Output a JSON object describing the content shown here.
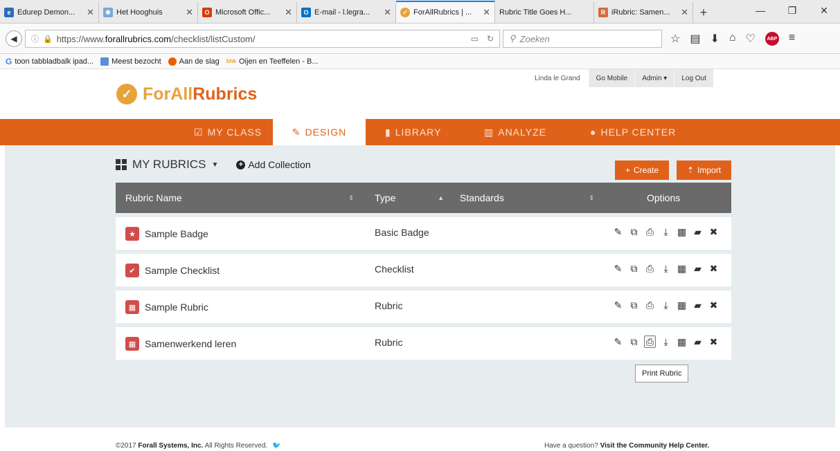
{
  "browser": {
    "tabs": [
      {
        "title": "Edurep Demon...",
        "favicon_color": "#2d6bb7",
        "active": false
      },
      {
        "title": "Het Hooghuis",
        "favicon_color": "#7aa7d6",
        "active": false
      },
      {
        "title": "Microsoft Offic...",
        "favicon_color": "#d83b01",
        "active": false
      },
      {
        "title": "E-mail - l.legra...",
        "favicon_color": "#0072c6",
        "active": false
      },
      {
        "title": "ForAllRubrics | ...",
        "favicon_color": "#e8a23a",
        "active": true
      },
      {
        "title": "Rubric Title Goes H...",
        "favicon_color": "",
        "active": false
      },
      {
        "title": "iRubric: Samen...",
        "favicon_color": "#d86a3a",
        "active": false
      }
    ],
    "url_prefix": "https://www.",
    "url_domain": "forallrubrics.com",
    "url_path": "/checklist/listCustom/",
    "search_placeholder": "Zoeken",
    "bookmarks": [
      {
        "label": "toon tabbladbalk ipad...",
        "icon": "google-icon"
      },
      {
        "label": "Meest bezocht",
        "icon": "most-visited-icon"
      },
      {
        "label": "Aan de slag",
        "icon": "firefox-icon"
      },
      {
        "label": "Oijen en Teeffelen - B...",
        "icon": "bhk-icon"
      }
    ]
  },
  "site": {
    "logo_text_a": "ForAll",
    "logo_text_b": "Rubrics",
    "user_name": "Linda le Grand",
    "go_mobile": "Go Mobile",
    "admin": "Admin ▾",
    "logout": "Log Out",
    "nav": [
      {
        "label": "MY CLASS",
        "icon": "check-square-icon"
      },
      {
        "label": "DESIGN",
        "icon": "pencil-icon"
      },
      {
        "label": "LIBRARY",
        "icon": "book-icon"
      },
      {
        "label": "ANALYZE",
        "icon": "bar-chart-icon"
      },
      {
        "label": "HELP CENTER",
        "icon": "comment-icon"
      }
    ]
  },
  "main": {
    "section_title": "MY RUBRICS",
    "add_collection": "Add Collection",
    "create_label": "Create",
    "import_label": "Import",
    "columns": {
      "name": "Rubric Name",
      "type": "Type",
      "standards": "Standards",
      "options": "Options"
    },
    "rows": [
      {
        "name": "Sample Badge",
        "type": "Basic Badge",
        "icon": "star-icon"
      },
      {
        "name": "Sample Checklist",
        "type": "Checklist",
        "icon": "check-icon"
      },
      {
        "name": "Sample Rubric",
        "type": "Rubric",
        "icon": "table-icon"
      },
      {
        "name": "Samenwerkend leren",
        "type": "Rubric",
        "icon": "table-icon"
      }
    ],
    "tooltip": "Print Rubric"
  },
  "footer": {
    "copyright_prefix": "©2017 ",
    "company": "Forall Systems, Inc.",
    "rights": " All Rights Reserved.",
    "question": "Have a question? ",
    "help_link": "Visit the Community Help Center."
  },
  "colors": {
    "brand_orange": "#e0621a",
    "logo_gold": "#e8a23a",
    "header_gray": "#6a6a6a",
    "content_bg": "#e7edee",
    "row_icon_red": "#d24c4c"
  }
}
